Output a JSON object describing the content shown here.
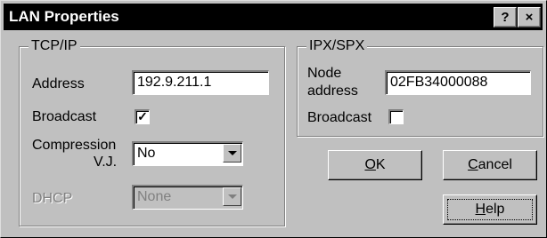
{
  "window": {
    "title": "LAN Properties",
    "help_button": "?",
    "close_button": "×"
  },
  "tcpip": {
    "group_title": "TCP/IP",
    "address_label": "Address",
    "address_value": "192.9.211.1",
    "broadcast_label": "Broadcast",
    "broadcast_checked": true,
    "compression_label_line1": "Compression",
    "compression_label_line2": "V.J.",
    "compression_value": "No",
    "dhcp_label": "DHCP",
    "dhcp_value": "None",
    "dhcp_enabled": false
  },
  "ipxspx": {
    "group_title": "IPX/SPX",
    "node_label_line1": "Node",
    "node_label_line2": "address",
    "node_value": "02FB34000088",
    "broadcast_label": "Broadcast",
    "broadcast_checked": false
  },
  "buttons": {
    "ok_mnemonic": "O",
    "ok_rest": "K",
    "cancel_mnemonic": "C",
    "cancel_rest": "ancel",
    "help_mnemonic": "H",
    "help_rest": "elp"
  },
  "colors": {
    "face": "#c0c0c0",
    "titlebar": "#000000",
    "disabled_text": "#808080"
  }
}
